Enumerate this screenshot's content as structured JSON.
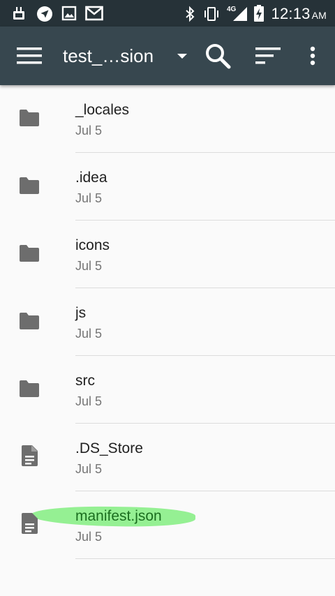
{
  "status_bar": {
    "time": "12:13",
    "ampm": "AM",
    "network": "4G",
    "icons": [
      "usb-debug-icon",
      "navigation-icon",
      "image-icon",
      "gmail-icon",
      "bluetooth-icon",
      "vibrate-icon",
      "signal-4g-icon",
      "battery-charging-icon"
    ]
  },
  "app_bar": {
    "title": "test_…sion",
    "icons": [
      "menu-icon",
      "dropdown-arrow-icon",
      "search-icon",
      "sort-icon",
      "more-vert-icon"
    ]
  },
  "files": [
    {
      "name": "_locales",
      "date": "Jul 5",
      "type": "folder"
    },
    {
      "name": ".idea",
      "date": "Jul 5",
      "type": "folder"
    },
    {
      "name": "icons",
      "date": "Jul 5",
      "type": "folder"
    },
    {
      "name": "js",
      "date": "Jul 5",
      "type": "folder"
    },
    {
      "name": "src",
      "date": "Jul 5",
      "type": "folder"
    },
    {
      "name": ".DS_Store",
      "date": "Jul 5",
      "type": "file"
    },
    {
      "name": "manifest.json",
      "date": "Jul 5",
      "type": "file",
      "highlighted": true
    }
  ],
  "colors": {
    "status_bar": "#263238",
    "app_bar": "#37474f",
    "icon_gray": "#6d6d6d",
    "highlight": "#8aee87"
  }
}
